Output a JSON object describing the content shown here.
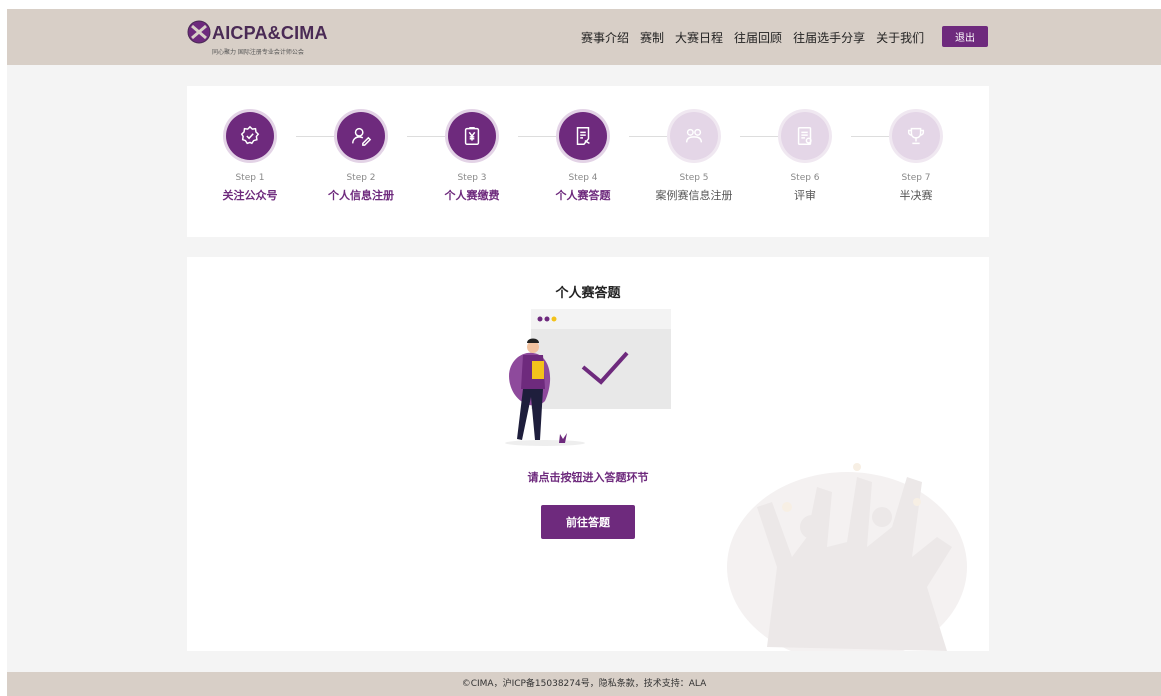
{
  "brand": {
    "name": "AICPA&CIMA",
    "tagline": "同心聚力  国际注册专业会计师公会"
  },
  "nav": {
    "items": [
      "赛事介绍",
      "赛制",
      "大赛日程",
      "往届回顾",
      "往届选手分享",
      "关于我们"
    ],
    "logout_label": "退出"
  },
  "steps": [
    {
      "num": "Step 1",
      "label": "关注公众号",
      "status": "done",
      "icon": "badge-check-icon"
    },
    {
      "num": "Step 2",
      "label": "个人信息注册",
      "status": "done",
      "icon": "user-edit-icon"
    },
    {
      "num": "Step 3",
      "label": "个人赛缴费",
      "status": "done",
      "icon": "payment-yuan-icon"
    },
    {
      "num": "Step 4",
      "label": "个人赛答题",
      "status": "done",
      "icon": "answer-sheet-icon"
    },
    {
      "num": "Step 5",
      "label": "案例赛信息注册",
      "status": "pending",
      "icon": "team-icon"
    },
    {
      "num": "Step 6",
      "label": "评审",
      "status": "pending",
      "icon": "review-doc-icon"
    },
    {
      "num": "Step 7",
      "label": "半决赛",
      "status": "pending",
      "icon": "trophy-icon"
    }
  ],
  "main": {
    "title": "个人赛答题",
    "prompt": "请点击按钮进入答题环节",
    "button_label": "前往答题"
  },
  "footer": {
    "text": "©CIMA，沪ICP备15038274号，隐私条款，技术支持：ALA"
  },
  "colors": {
    "accent": "#6e2a7d",
    "accent_light": "#e4d6e7",
    "header_bg": "#d8cfc7"
  }
}
